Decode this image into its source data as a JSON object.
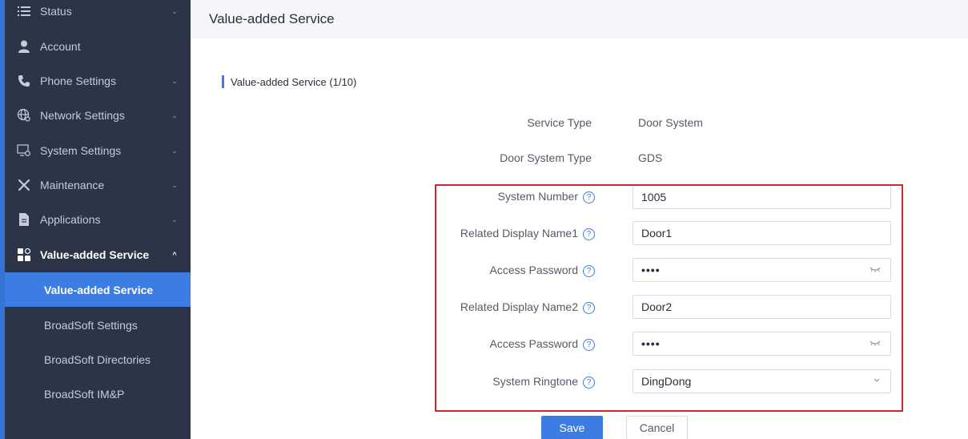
{
  "sidebar": {
    "items": [
      {
        "label": "Status",
        "icon": "list-icon",
        "chevron": "⌄"
      },
      {
        "label": "Account",
        "icon": "person-icon",
        "chevron": ""
      },
      {
        "label": "Phone Settings",
        "icon": "phone-icon",
        "chevron": "⌄"
      },
      {
        "label": "Network Settings",
        "icon": "globe-gear-icon",
        "chevron": "⌄"
      },
      {
        "label": "System Settings",
        "icon": "monitor-gear-icon",
        "chevron": "⌄"
      },
      {
        "label": "Maintenance",
        "icon": "tools-icon",
        "chevron": "⌄"
      },
      {
        "label": "Applications",
        "icon": "document-icon",
        "chevron": "⌄"
      },
      {
        "label": "Value-added Service",
        "icon": "apps-grid-icon",
        "chevron": "^"
      }
    ],
    "sub_items": [
      {
        "label": "Value-added Service",
        "active": true
      },
      {
        "label": "BroadSoft Settings",
        "active": false
      },
      {
        "label": "BroadSoft Directories",
        "active": false
      },
      {
        "label": "BroadSoft IM&P",
        "active": false
      }
    ]
  },
  "header": {
    "title": "Value-added Service"
  },
  "section": {
    "title": "Value-added Service (1/10)"
  },
  "form": {
    "service_type": {
      "label": "Service Type",
      "value": "Door System"
    },
    "door_system_type": {
      "label": "Door System Type",
      "value": "GDS"
    },
    "system_number": {
      "label": "System Number",
      "value": "1005"
    },
    "display_name1": {
      "label": "Related Display Name1",
      "value": "Door1"
    },
    "access_password1": {
      "label": "Access Password",
      "value": "••••"
    },
    "display_name2": {
      "label": "Related Display Name2",
      "value": "Door2"
    },
    "access_password2": {
      "label": "Access Password",
      "value": "••••"
    },
    "system_ringtone": {
      "label": "System Ringtone",
      "value": "DingDong"
    }
  },
  "buttons": {
    "save": "Save",
    "cancel": "Cancel"
  },
  "colors": {
    "sidebar_bg": "#2b3547",
    "accent": "#3b7de3",
    "highlight": "#d8232a"
  }
}
